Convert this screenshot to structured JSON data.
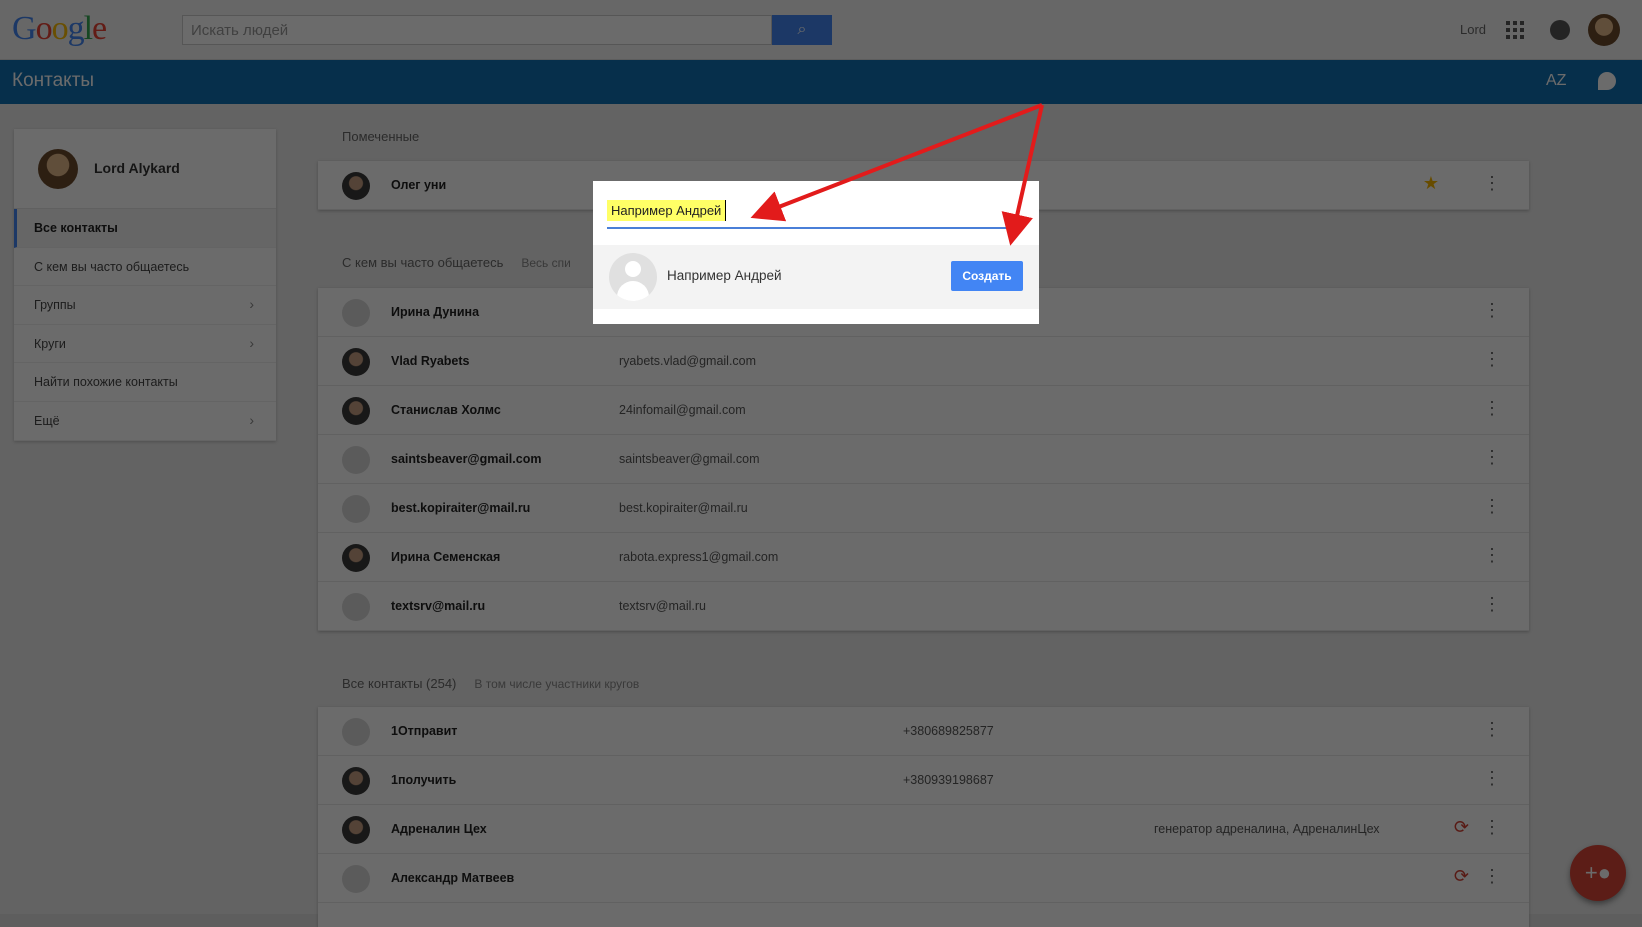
{
  "topbar": {
    "logo": "Google",
    "search_placeholder": "Искать людей",
    "user": "Lord"
  },
  "appbar": {
    "title": "Контакты",
    "sort": "AZ"
  },
  "sidebar": {
    "user": "Lord Alykard",
    "items": [
      {
        "label": "Все контакты"
      },
      {
        "label": "С кем вы часто общаетесь"
      },
      {
        "label": "Группы"
      },
      {
        "label": "Круги"
      },
      {
        "label": "Найти похожие контакты"
      },
      {
        "label": "Ещё"
      }
    ]
  },
  "starred": {
    "title": "Помеченные",
    "rows": [
      {
        "name": "Олег уни"
      }
    ]
  },
  "frequent": {
    "title": "С кем вы часто общаетесь",
    "subtitle": "Весь спи",
    "rows": [
      {
        "name": "Ирина Дунина",
        "email": ""
      },
      {
        "name": "Vlad Ryabets",
        "email": "ryabets.vlad@gmail.com"
      },
      {
        "name": "Станислав Холмс",
        "email": "24infomail@gmail.com"
      },
      {
        "name": "saintsbeaver@gmail.com",
        "email": "saintsbeaver@gmail.com"
      },
      {
        "name": "best.kopiraiter@mail.ru",
        "email": "best.kopiraiter@mail.ru"
      },
      {
        "name": "Ирина Семенская",
        "email": "rabota.express1@gmail.com"
      },
      {
        "name": "textsrv@mail.ru",
        "email": "textsrv@mail.ru"
      }
    ]
  },
  "all": {
    "title": "Все контакты (254)",
    "subtitle": "В том числе участники кругов",
    "rows": [
      {
        "name": "1Отправит",
        "phone": "+380689825877",
        "circles": ""
      },
      {
        "name": "1получить",
        "phone": "+380939198687",
        "circles": ""
      },
      {
        "name": "Адреналин Цех",
        "phone": "",
        "circles": "генератор адреналина, АдреналинЦех"
      },
      {
        "name": "Александр Матвеев",
        "phone": "",
        "circles": ""
      }
    ]
  },
  "dialog": {
    "input_value": "Например Андрей",
    "suggestion": "Например Андрей",
    "create_label": "Создать"
  }
}
